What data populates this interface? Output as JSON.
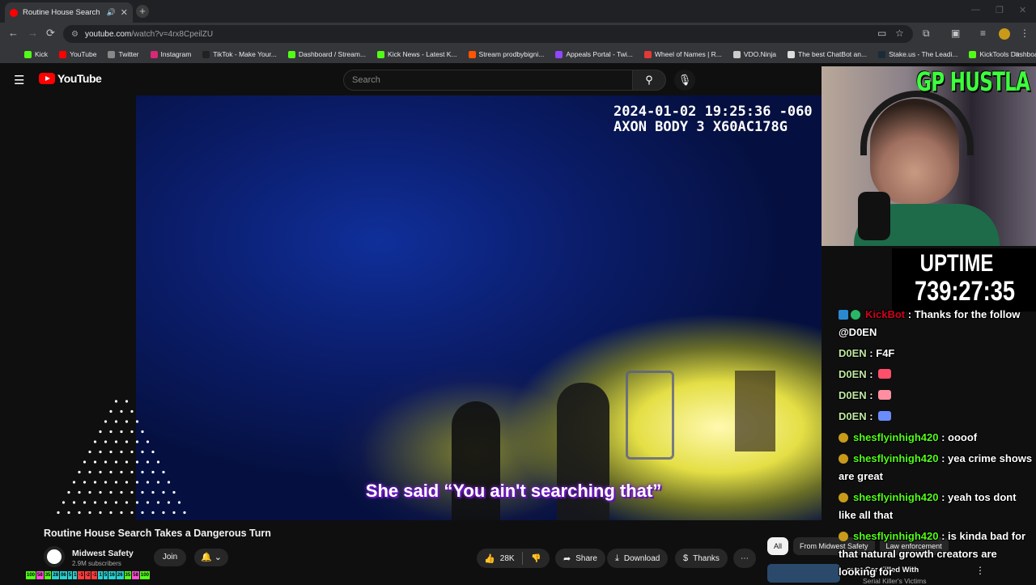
{
  "browser": {
    "tab_title": "Routine House Search Takes",
    "url_host": "youtube.com",
    "url_path": "/watch?v=4rx8CpeilZU",
    "bookmarks": [
      {
        "label": "Kick",
        "color": "#53fc18"
      },
      {
        "label": "YouTube",
        "color": "#ff0000"
      },
      {
        "label": "Twitter",
        "color": "#888888"
      },
      {
        "label": "Instagram",
        "color": "#d62976"
      },
      {
        "label": "TikTok - Make Your...",
        "color": "#222222"
      },
      {
        "label": "Dashboard / Stream...",
        "color": "#53fc18"
      },
      {
        "label": "Kick News - Latest K...",
        "color": "#53fc18"
      },
      {
        "label": "Stream prodbybigni...",
        "color": "#ff5500"
      },
      {
        "label": "Appeals Portal - Twi...",
        "color": "#9146ff"
      },
      {
        "label": "Wheel of Names | R...",
        "color": "#e53935"
      },
      {
        "label": "VDO.Ninja",
        "color": "#cccccc"
      },
      {
        "label": "The best ChatBot an...",
        "color": "#dddddd"
      },
      {
        "label": "Stake.us - The Leadi...",
        "color": "#1a2c38"
      },
      {
        "label": "KickTools Dashboard",
        "color": "#53fc18"
      }
    ]
  },
  "youtube": {
    "logo_text": "YouTube",
    "search_placeholder": "Search"
  },
  "video": {
    "timestamp_line1": "2024-01-02 19:25:36 -060",
    "timestamp_line2": "AXON BODY 3 X60AC178G",
    "caption": "She said “You ain't searching that”"
  },
  "below_video": {
    "title": "Routine House Search Takes a Dangerous Turn",
    "channel_name": "Midwest Safety",
    "channel_subs": "2.9M subscribers",
    "join_label": "Join",
    "likes": "28K",
    "share_label": "Share",
    "download_label": "Download",
    "thanks_label": "Thanks"
  },
  "chips": [
    "All",
    "From Midwest Safety",
    "Law enforcement"
  ],
  "recommended": {
    "title": "over Car Filled With",
    "subtitle": "Serial Killer's Victims"
  },
  "stats": [
    {
      "label": "100",
      "color": "#53fc18"
    },
    {
      "label": "58",
      "color": "#ff4fd8"
    },
    {
      "label": "35",
      "color": "#53fc18"
    },
    {
      "label": "28",
      "color": "#2ad0d0"
    },
    {
      "label": "06",
      "color": "#2ad0d0"
    },
    {
      "label": "5",
      "color": "#2ad0d0"
    },
    {
      "label": "1",
      "color": "#2ad0d0"
    },
    {
      "label": "-1",
      "color": "#ff3b3b"
    },
    {
      "label": "-2",
      "color": "#ff3b3b"
    },
    {
      "label": "-1",
      "color": "#ff3b3b"
    },
    {
      "label": "1",
      "color": "#2ad0d0"
    },
    {
      "label": "5",
      "color": "#2ad0d0"
    },
    {
      "label": "16",
      "color": "#2ad0d0"
    },
    {
      "label": "26",
      "color": "#2ad0d0"
    },
    {
      "label": "35",
      "color": "#53fc18"
    },
    {
      "label": "58",
      "color": "#ff4fd8"
    },
    {
      "label": "100",
      "color": "#53fc18"
    }
  ],
  "overlay": {
    "gp_text": "GP HUSTLA",
    "uptime_label": "UPTIME",
    "uptime_value": "739:27:35"
  },
  "chat": [
    {
      "user": "KickBot",
      "text": "Thanks for the follow @D0EN",
      "style": "bot"
    },
    {
      "user": "D0EN",
      "text": "F4F",
      "style": "doen"
    },
    {
      "user": "D0EN",
      "text": "",
      "style": "doen",
      "emote": "#ff4f6a"
    },
    {
      "user": "D0EN",
      "text": "",
      "style": "doen",
      "emote": "#ff8fa0"
    },
    {
      "user": "D0EN",
      "text": "",
      "style": "doen",
      "emote": "#6a8cff"
    },
    {
      "user": "shesflyinhigh420",
      "text": "oooof",
      "style": "gold"
    },
    {
      "user": "shesflyinhigh420",
      "text": "yea crime shows are great",
      "style": "gold"
    },
    {
      "user": "shesflyinhigh420",
      "text": "yeah tos dont like all that",
      "style": "gold"
    },
    {
      "user": "shesflyinhigh420",
      "text": "is kinda bad for that natural growth creators are looking for",
      "style": "gold"
    }
  ]
}
